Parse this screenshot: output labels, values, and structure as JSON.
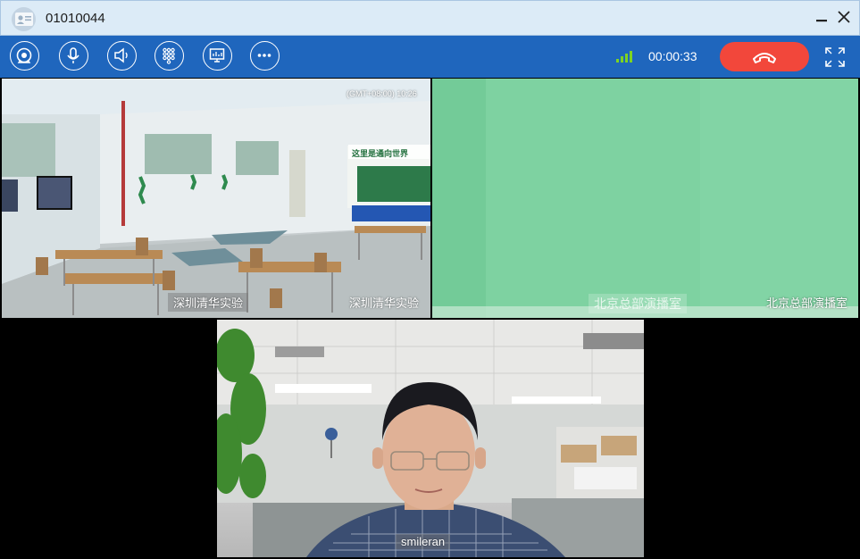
{
  "window": {
    "title": "01010044",
    "minimize_label": "–",
    "close_label": "✕"
  },
  "toolbar": {
    "buttons": [
      {
        "icon": "camera-icon"
      },
      {
        "icon": "microphone-icon"
      },
      {
        "icon": "speaker-icon"
      },
      {
        "icon": "dialpad-icon"
      },
      {
        "icon": "screen-share-icon"
      },
      {
        "icon": "more-icon"
      }
    ],
    "signal_icon": "signal-strength-icon",
    "call_duration": "00:00:33",
    "hangup_icon": "phone-hangup-icon",
    "hangup_color": "#f2473b",
    "fullscreen_icon": "fullscreen-icon",
    "accent_color": "#1f66bd"
  },
  "video_tiles": {
    "classroom": {
      "timestamp": "(GMT+08:00) 10:26",
      "embedded_name": "深圳清华实验",
      "participant_name": "深圳清华实验",
      "wall_sign": "这里是通向世界"
    },
    "studio": {
      "embedded_name": "北京总部演播室",
      "participant_name": "北京总部演播室"
    },
    "office": {
      "participant_name": "smileran"
    }
  }
}
